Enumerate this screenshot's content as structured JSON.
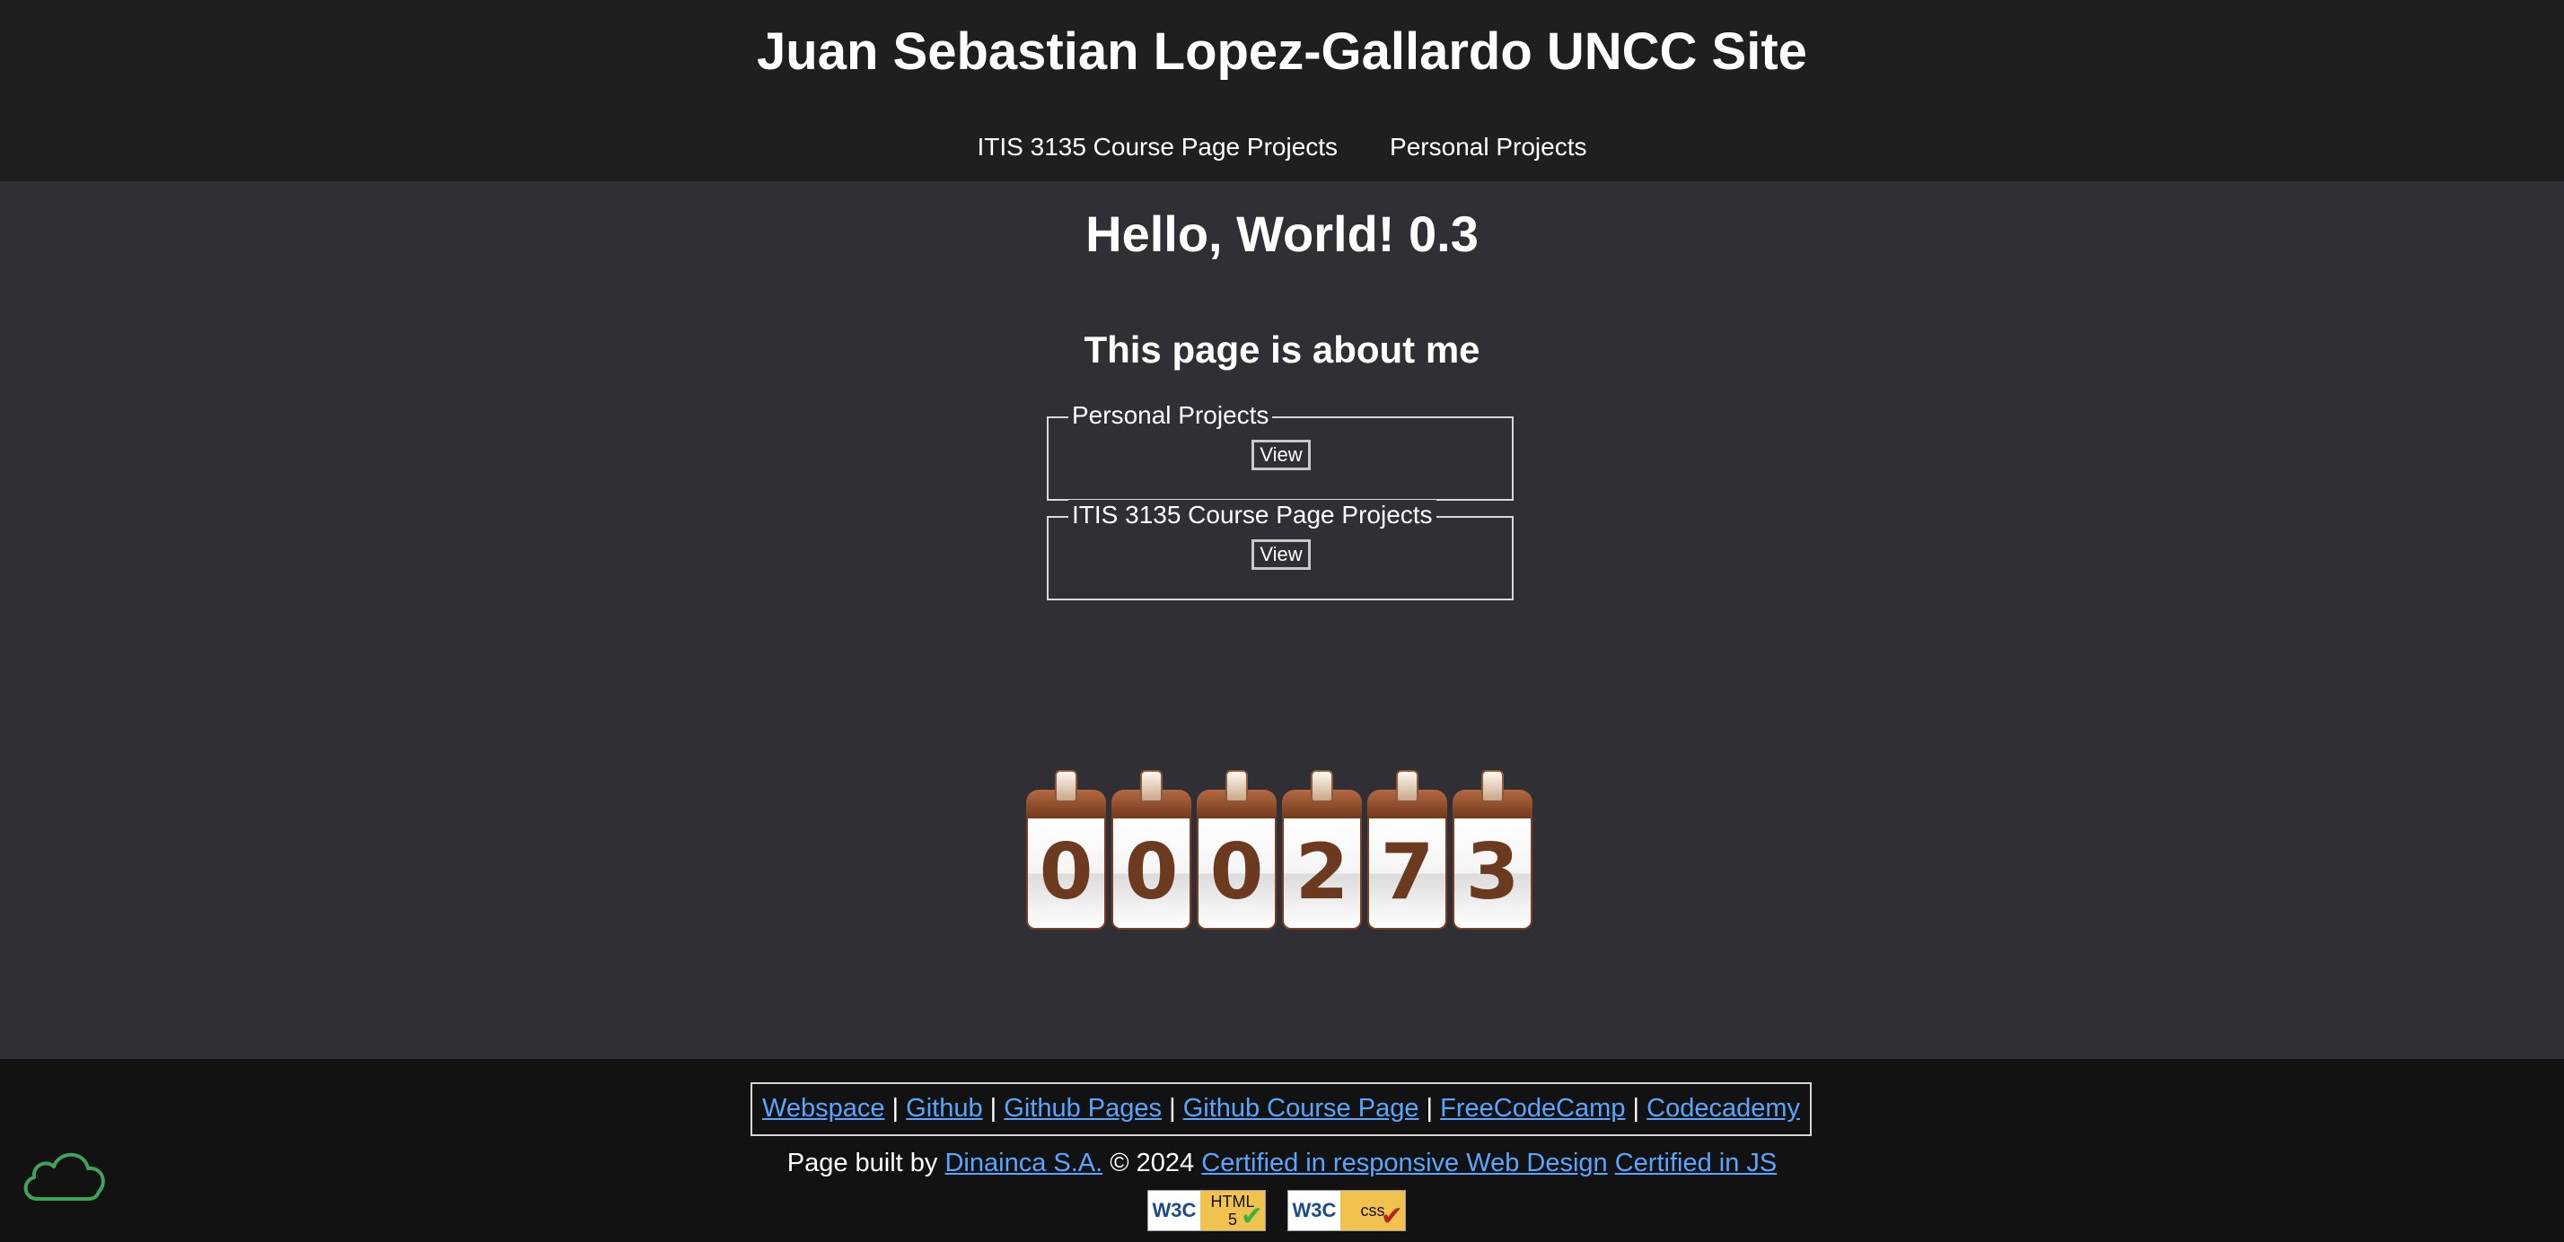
{
  "header": {
    "title": "Juan Sebastian Lopez-Gallardo UNCC Site",
    "nav": [
      {
        "label": "ITIS 3135 Course Page Projects"
      },
      {
        "label": "Personal Projects"
      }
    ]
  },
  "main": {
    "heading": "Hello, World! 0.3",
    "subheading": "This page is about me",
    "sections": [
      {
        "legend": "Personal Projects",
        "button": "View"
      },
      {
        "legend": "ITIS 3135 Course Page Projects",
        "button": "View"
      }
    ],
    "hit_counter": [
      "0",
      "0",
      "0",
      "2",
      "7",
      "3"
    ]
  },
  "footer": {
    "links": [
      {
        "label": "Webspace"
      },
      {
        "label": "Github"
      },
      {
        "label": "Github Pages"
      },
      {
        "label": "Github Course Page"
      },
      {
        "label": "FreeCodeCamp"
      },
      {
        "label": "Codecademy"
      }
    ],
    "separator": "|",
    "built_prefix": "Page built by",
    "builder_link": "Dinainca S.A.",
    "copyright": "© 2024",
    "cert_links": [
      {
        "label": "Certified in responsive Web Design"
      },
      {
        "label": "Certified in JS"
      }
    ],
    "badges": [
      {
        "w3c": "W3C",
        "kind_line1": "HTML",
        "kind_line2": "5"
      },
      {
        "w3c": "W3C",
        "kind_line1": "css",
        "kind_line2": ""
      }
    ]
  },
  "colors": {
    "header_bg": "#1f1f1f",
    "page_bg": "#302f36",
    "footer_bg": "#121212",
    "link": "#58a6ff",
    "cloud_icon": "#3fa35a"
  },
  "icons": {
    "cloud": "cloud-icon"
  }
}
